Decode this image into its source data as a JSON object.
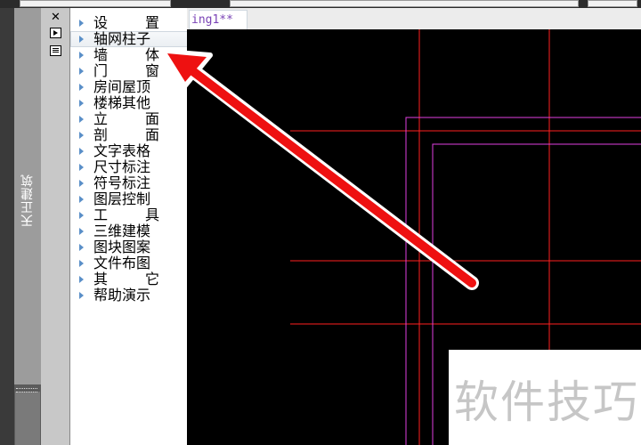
{
  "panel": {
    "title": "天正建筑",
    "controls": {
      "close_icon": "close-icon",
      "pin_icon": "pin-icon",
      "menu_icon": "menu-icon"
    },
    "items": [
      {
        "label": "设  置",
        "chars": [
          "设",
          "置"
        ],
        "spread": true
      },
      {
        "label": "轴网柱子",
        "chars": [
          "轴网柱子"
        ],
        "spread": false,
        "selected": true
      },
      {
        "label": "墙  体",
        "chars": [
          "墙",
          "体"
        ],
        "spread": true
      },
      {
        "label": "门  窗",
        "chars": [
          "门",
          "窗"
        ],
        "spread": true
      },
      {
        "label": "房间屋顶",
        "chars": [
          "房间屋顶"
        ],
        "spread": false
      },
      {
        "label": "楼梯其他",
        "chars": [
          "楼梯其他"
        ],
        "spread": false
      },
      {
        "label": "立  面",
        "chars": [
          "立",
          "面"
        ],
        "spread": true
      },
      {
        "label": "剖  面",
        "chars": [
          "剖",
          "面"
        ],
        "spread": true
      },
      {
        "label": "文字表格",
        "chars": [
          "文字表格"
        ],
        "spread": false
      },
      {
        "label": "尺寸标注",
        "chars": [
          "尺寸标注"
        ],
        "spread": false
      },
      {
        "label": "符号标注",
        "chars": [
          "符号标注"
        ],
        "spread": false
      },
      {
        "label": "图层控制",
        "chars": [
          "图层控制"
        ],
        "spread": false
      },
      {
        "label": "工  具",
        "chars": [
          "工",
          "具"
        ],
        "spread": true
      },
      {
        "label": "三维建模",
        "chars": [
          "三维建模"
        ],
        "spread": false
      },
      {
        "label": "图块图案",
        "chars": [
          "图块图案"
        ],
        "spread": false
      },
      {
        "label": "文件布图",
        "chars": [
          "文件布图"
        ],
        "spread": false
      },
      {
        "label": "其  它",
        "chars": [
          "其",
          "它"
        ],
        "spread": true
      },
      {
        "label": "帮助演示",
        "chars": [
          "帮助演示"
        ],
        "spread": false
      }
    ]
  },
  "drawing": {
    "tab_label": "ing1**",
    "grid_color": "#ff2020",
    "wall_color": "#e040e0"
  },
  "annotation": {
    "arrow_color": "#ee1111",
    "arrow_icon": "red-arrow-icon"
  },
  "watermark": {
    "text": "软件技巧"
  }
}
